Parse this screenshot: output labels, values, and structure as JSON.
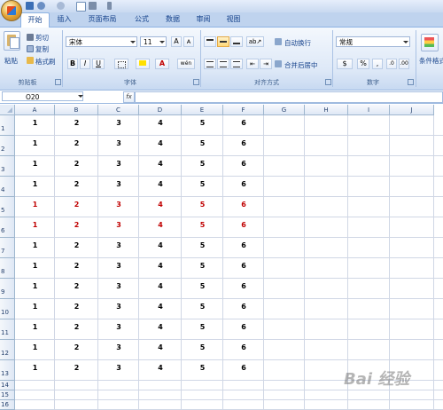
{
  "quick_access": {
    "icons": [
      "save-icon",
      "undo-icon",
      "redo-icon",
      "new-icon",
      "print-icon",
      "customize-icon"
    ]
  },
  "tabs": [
    "开始",
    "插入",
    "页面布局",
    "公式",
    "数据",
    "审阅",
    "视图"
  ],
  "active_tab_index": 0,
  "ribbon": {
    "clipboard": {
      "paste": "粘贴",
      "cut": "剪切",
      "copy": "复制",
      "format_painter": "格式刷",
      "label": "剪贴板"
    },
    "font": {
      "font_name": "宋体",
      "font_size": "11",
      "bold": "B",
      "italic": "I",
      "underline": "U",
      "grow": "A",
      "shrink": "A",
      "phonetic": "wén",
      "label": "字体"
    },
    "alignment": {
      "wrap_text": "自动换行",
      "merge_center": "合并后居中",
      "label": "对齐方式"
    },
    "number": {
      "format": "常规",
      "currency": "$",
      "percent": "%",
      "comma": ",",
      "label": "数字"
    },
    "styles": {
      "conditional": "条件格式"
    }
  },
  "formula_bar": {
    "name_box": "O20",
    "fx": "fx",
    "content": ""
  },
  "columns": [
    "A",
    "B",
    "C",
    "D",
    "E",
    "F",
    "G",
    "H",
    "I",
    "J"
  ],
  "rows": [
    "1",
    "2",
    "3",
    "4",
    "5",
    "6",
    "7",
    "8",
    "9",
    "10",
    "11",
    "12",
    "13",
    "14",
    "15",
    "16"
  ],
  "data_rows": [
    [
      "1",
      "2",
      "3",
      "4",
      "5",
      "6"
    ],
    [
      "1",
      "2",
      "3",
      "4",
      "5",
      "6"
    ],
    [
      "1",
      "2",
      "3",
      "4",
      "5",
      "6"
    ],
    [
      "1",
      "2",
      "3",
      "4",
      "5",
      "6"
    ],
    [
      "1",
      "2",
      "3",
      "4",
      "5",
      "6"
    ],
    [
      "1",
      "2",
      "3",
      "4",
      "5",
      "6"
    ],
    [
      "1",
      "2",
      "3",
      "4",
      "5",
      "6"
    ],
    [
      "1",
      "2",
      "3",
      "4",
      "5",
      "6"
    ],
    [
      "1",
      "2",
      "3",
      "4",
      "5",
      "6"
    ],
    [
      "1",
      "2",
      "3",
      "4",
      "5",
      "6"
    ],
    [
      "1",
      "2",
      "3",
      "4",
      "5",
      "6"
    ],
    [
      "1",
      "2",
      "3",
      "4",
      "5",
      "6"
    ],
    [
      "1",
      "2",
      "3",
      "4",
      "5",
      "6"
    ]
  ],
  "highlighted_rows": [
    4,
    5
  ],
  "colors": {
    "highlight_text": "#c00000",
    "ribbon": "#dde8f7",
    "grid_line": "#d0d7e5"
  },
  "watermark": "Bai 经验"
}
